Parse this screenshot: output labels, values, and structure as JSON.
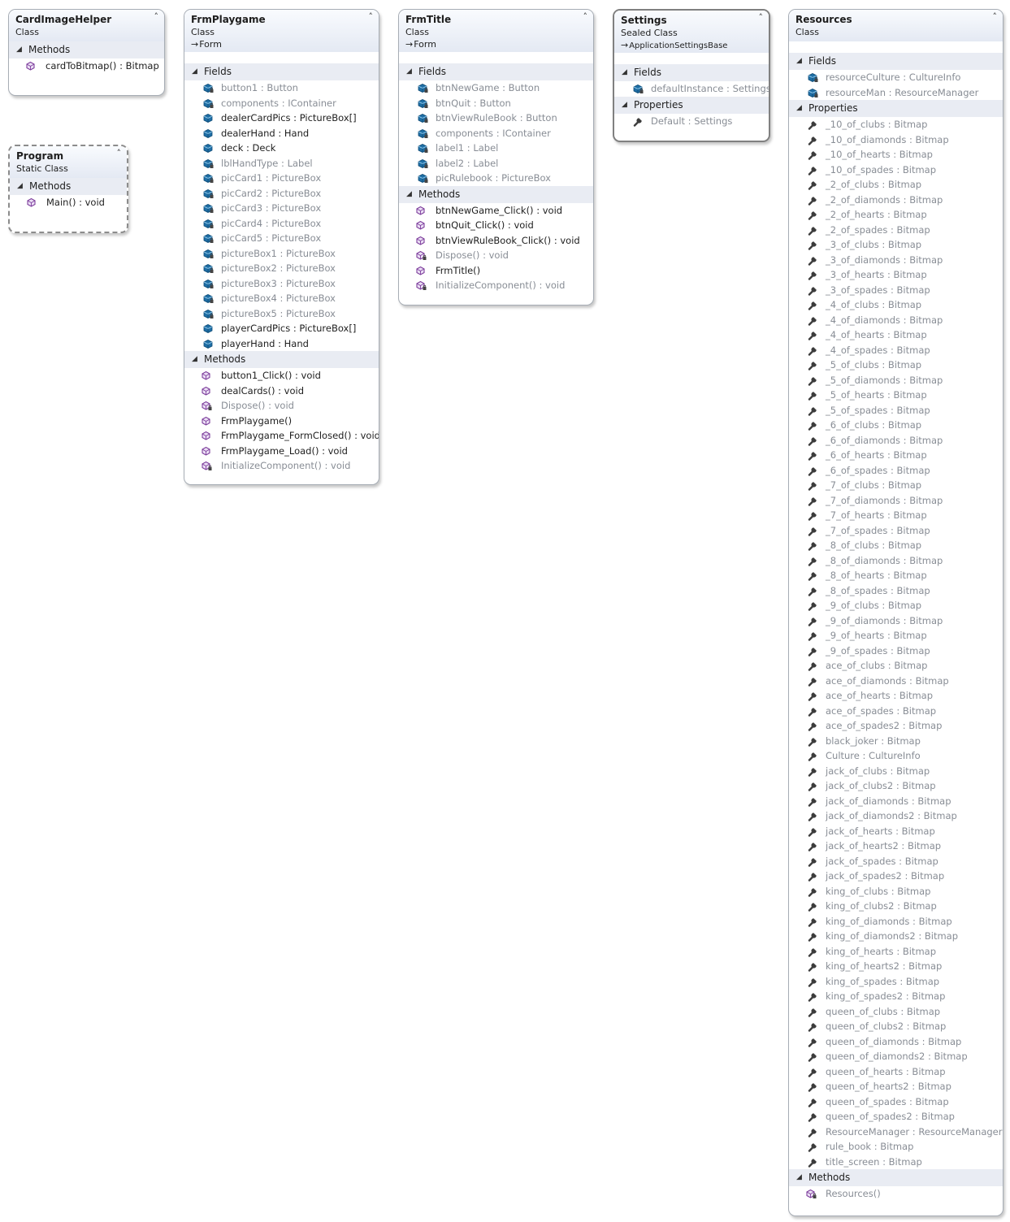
{
  "colors": {
    "field_icon": "#1f6fa6",
    "method_icon": "#7e3f9d",
    "property_icon": "#3c3c3c",
    "header_bg": "#e4e9f3",
    "private_text": "#888d95"
  },
  "classes": {
    "cardimagehelper": {
      "name": "CardImageHelper",
      "kind": "Class",
      "methods_label": "Methods",
      "methods": [
        {
          "text": "cardToBitmap() : Bitmap",
          "private": false
        }
      ]
    },
    "program": {
      "name": "Program",
      "kind": "Static Class",
      "methods_label": "Methods",
      "methods": [
        {
          "text": "Main() : void",
          "private": false
        }
      ]
    },
    "frmplaygame": {
      "name": "FrmPlaygame",
      "kind": "Class",
      "base": "Form",
      "fields_label": "Fields",
      "fields": [
        {
          "text": "button1 : Button",
          "private": true
        },
        {
          "text": "components : IContainer",
          "private": true
        },
        {
          "text": "dealerCardPics : PictureBox[]",
          "private": false
        },
        {
          "text": "dealerHand : Hand",
          "private": false
        },
        {
          "text": "deck : Deck",
          "private": false
        },
        {
          "text": "lblHandType : Label",
          "private": true
        },
        {
          "text": "picCard1 : PictureBox",
          "private": true
        },
        {
          "text": "picCard2 : PictureBox",
          "private": true
        },
        {
          "text": "picCard3 : PictureBox",
          "private": true
        },
        {
          "text": "picCard4 : PictureBox",
          "private": true
        },
        {
          "text": "picCard5 : PictureBox",
          "private": true
        },
        {
          "text": "pictureBox1 : PictureBox",
          "private": true
        },
        {
          "text": "pictureBox2 : PictureBox",
          "private": true
        },
        {
          "text": "pictureBox3 : PictureBox",
          "private": true
        },
        {
          "text": "pictureBox4 : PictureBox",
          "private": true
        },
        {
          "text": "pictureBox5 : PictureBox",
          "private": true
        },
        {
          "text": "playerCardPics : PictureBox[]",
          "private": false
        },
        {
          "text": "playerHand : Hand",
          "private": false
        }
      ],
      "methods_label": "Methods",
      "methods": [
        {
          "text": "button1_Click() : void",
          "private": false
        },
        {
          "text": "dealCards() : void",
          "private": false
        },
        {
          "text": "Dispose() : void",
          "private": true
        },
        {
          "text": "FrmPlaygame()",
          "private": false
        },
        {
          "text": "FrmPlaygame_FormClosed() : void",
          "private": false
        },
        {
          "text": "FrmPlaygame_Load() : void",
          "private": false
        },
        {
          "text": "InitializeComponent() : void",
          "private": true
        }
      ]
    },
    "frmtitle": {
      "name": "FrmTitle",
      "kind": "Class",
      "base": "Form",
      "fields_label": "Fields",
      "fields": [
        {
          "text": "btnNewGame : Button",
          "private": true
        },
        {
          "text": "btnQuit : Button",
          "private": true
        },
        {
          "text": "btnViewRuleBook : Button",
          "private": true
        },
        {
          "text": "components : IContainer",
          "private": true
        },
        {
          "text": "label1 : Label",
          "private": true
        },
        {
          "text": "label2 : Label",
          "private": true
        },
        {
          "text": "picRulebook : PictureBox",
          "private": true
        }
      ],
      "methods_label": "Methods",
      "methods": [
        {
          "text": "btnNewGame_Click() : void",
          "private": false
        },
        {
          "text": "btnQuit_Click() : void",
          "private": false
        },
        {
          "text": "btnViewRuleBook_Click() : void",
          "private": false
        },
        {
          "text": "Dispose() : void",
          "private": true
        },
        {
          "text": "FrmTitle()",
          "private": false
        },
        {
          "text": "InitializeComponent() : void",
          "private": true
        }
      ]
    },
    "settings": {
      "name": "Settings",
      "kind": "Sealed Class",
      "base": "ApplicationSettingsBase",
      "fields_label": "Fields",
      "fields": [
        {
          "text": "defaultInstance : Settings",
          "private": true
        }
      ],
      "properties_label": "Properties",
      "properties": [
        {
          "text": "Default : Settings",
          "private": true
        }
      ]
    },
    "resources": {
      "name": "Resources",
      "kind": "Class",
      "fields_label": "Fields",
      "fields": [
        {
          "text": "resourceCulture : CultureInfo",
          "private": true
        },
        {
          "text": "resourceMan : ResourceManager",
          "private": true
        }
      ],
      "properties_label": "Properties",
      "properties": [
        "_10_of_clubs : Bitmap",
        "_10_of_diamonds : Bitmap",
        "_10_of_hearts : Bitmap",
        "_10_of_spades : Bitmap",
        "_2_of_clubs : Bitmap",
        "_2_of_diamonds : Bitmap",
        "_2_of_hearts : Bitmap",
        "_2_of_spades : Bitmap",
        "_3_of_clubs : Bitmap",
        "_3_of_diamonds : Bitmap",
        "_3_of_hearts : Bitmap",
        "_3_of_spades : Bitmap",
        "_4_of_clubs : Bitmap",
        "_4_of_diamonds : Bitmap",
        "_4_of_hearts : Bitmap",
        "_4_of_spades : Bitmap",
        "_5_of_clubs : Bitmap",
        "_5_of_diamonds : Bitmap",
        "_5_of_hearts : Bitmap",
        "_5_of_spades : Bitmap",
        "_6_of_clubs : Bitmap",
        "_6_of_diamonds : Bitmap",
        "_6_of_hearts : Bitmap",
        "_6_of_spades : Bitmap",
        "_7_of_clubs : Bitmap",
        "_7_of_diamonds : Bitmap",
        "_7_of_hearts : Bitmap",
        "_7_of_spades : Bitmap",
        "_8_of_clubs : Bitmap",
        "_8_of_diamonds : Bitmap",
        "_8_of_hearts : Bitmap",
        "_8_of_spades : Bitmap",
        "_9_of_clubs : Bitmap",
        "_9_of_diamonds : Bitmap",
        "_9_of_hearts : Bitmap",
        "_9_of_spades : Bitmap",
        "ace_of_clubs : Bitmap",
        "ace_of_diamonds : Bitmap",
        "ace_of_hearts : Bitmap",
        "ace_of_spades : Bitmap",
        "ace_of_spades2 : Bitmap",
        "black_joker : Bitmap",
        "Culture : CultureInfo",
        "jack_of_clubs : Bitmap",
        "jack_of_clubs2 : Bitmap",
        "jack_of_diamonds : Bitmap",
        "jack_of_diamonds2 : Bitmap",
        "jack_of_hearts : Bitmap",
        "jack_of_hearts2 : Bitmap",
        "jack_of_spades : Bitmap",
        "jack_of_spades2 : Bitmap",
        "king_of_clubs : Bitmap",
        "king_of_clubs2 : Bitmap",
        "king_of_diamonds : Bitmap",
        "king_of_diamonds2 : Bitmap",
        "king_of_hearts : Bitmap",
        "king_of_hearts2 : Bitmap",
        "king_of_spades : Bitmap",
        "king_of_spades2 : Bitmap",
        "queen_of_clubs : Bitmap",
        "queen_of_clubs2 : Bitmap",
        "queen_of_diamonds : Bitmap",
        "queen_of_diamonds2 : Bitmap",
        "queen_of_hearts : Bitmap",
        "queen_of_hearts2 : Bitmap",
        "queen_of_spades : Bitmap",
        "queen_of_spades2 : Bitmap",
        "ResourceManager : ResourceManager",
        "rule_book : Bitmap",
        "title_screen : Bitmap"
      ],
      "methods_label": "Methods",
      "methods": [
        {
          "text": "Resources()",
          "private": true
        }
      ]
    }
  }
}
